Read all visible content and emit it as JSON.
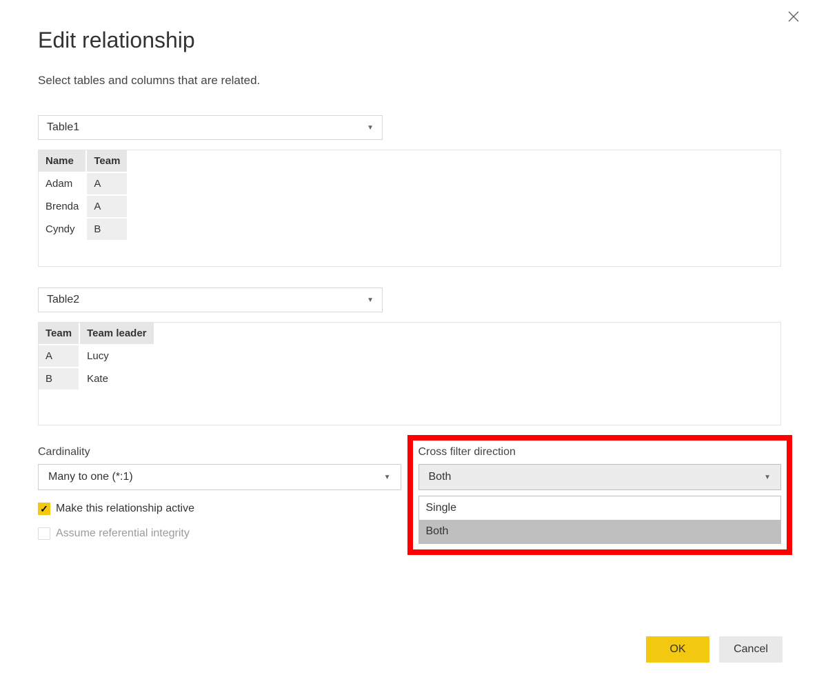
{
  "dialog": {
    "title": "Edit relationship",
    "subtitle": "Select tables and columns that are related.",
    "close_icon": "close"
  },
  "table1": {
    "selected": "Table1",
    "preview": {
      "headers": [
        "Name",
        "Team"
      ],
      "rows": [
        [
          "Adam",
          "A"
        ],
        [
          "Brenda",
          "A"
        ],
        [
          "Cyndy",
          "B"
        ]
      ],
      "selected_col_index": 1
    }
  },
  "table2": {
    "selected": "Table2",
    "preview": {
      "headers": [
        "Team",
        "Team leader"
      ],
      "rows": [
        [
          "A",
          "Lucy"
        ],
        [
          "B",
          "Kate"
        ]
      ],
      "selected_col_index": 0
    }
  },
  "options": {
    "cardinality": {
      "label": "Cardinality",
      "value": "Many to one (*:1)"
    },
    "cross_filter": {
      "label": "Cross filter direction",
      "value": "Both",
      "options": [
        "Single",
        "Both"
      ],
      "open": true,
      "highlighted": true
    },
    "active": {
      "label": "Make this relationship active",
      "checked": true
    },
    "referential": {
      "label": "Assume referential integrity",
      "checked": false,
      "disabled": true
    }
  },
  "footer": {
    "ok": "OK",
    "cancel": "Cancel"
  }
}
